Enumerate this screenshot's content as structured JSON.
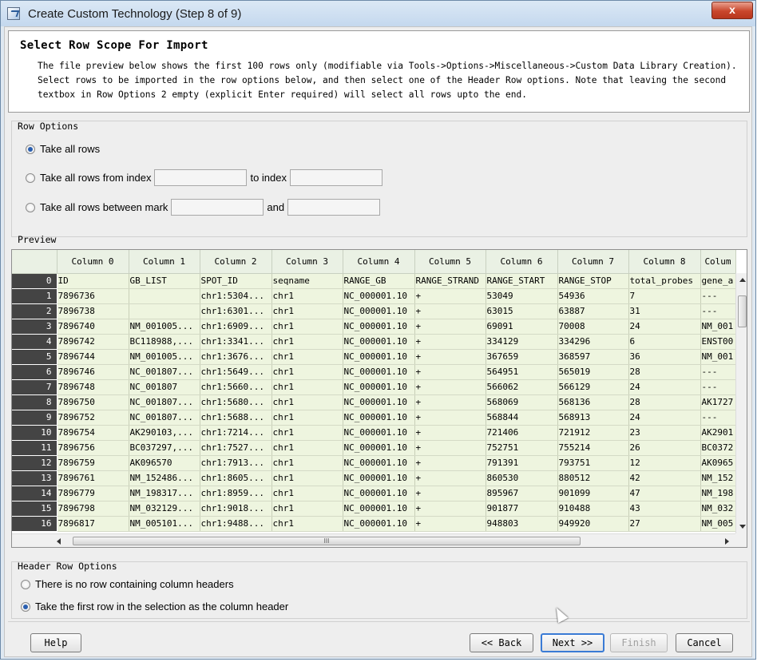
{
  "window": {
    "title": "Create Custom Technology (Step 8 of 9)",
    "close_label": "x"
  },
  "header": {
    "title": "Select Row Scope For Import",
    "description": "The file preview below shows the first 100 rows only (modifiable via Tools->Options->Miscellaneous->Custom Data Library Creation). Select rows to be imported in the row options below, and then select one of the Header Row options. Note that leaving the second textbox in Row Options 2 empty (explicit Enter required) will select all rows upto the end."
  },
  "row_options": {
    "label": "Row Options",
    "all_rows": "Take all rows",
    "from_index": "Take all rows from index",
    "to_index": "to index",
    "between_mark": "Take all rows between mark",
    "and": "and",
    "selected": "all_rows"
  },
  "preview": {
    "label": "Preview",
    "columns": [
      "Column 0",
      "Column 1",
      "Column 2",
      "Column 3",
      "Column 4",
      "Column 5",
      "Column 6",
      "Column 7",
      "Column 8",
      "Colum"
    ],
    "rows": [
      [
        "0",
        "ID",
        "GB_LIST",
        "SPOT_ID",
        "seqname",
        "RANGE_GB",
        "RANGE_STRAND",
        "RANGE_START",
        "RANGE_STOP",
        "total_probes",
        "gene_a"
      ],
      [
        "1",
        "7896736",
        "",
        "chr1:5304...",
        "chr1",
        "NC_000001.10",
        "+",
        "53049",
        "54936",
        "7",
        "---"
      ],
      [
        "2",
        "7896738",
        "",
        "chr1:6301...",
        "chr1",
        "NC_000001.10",
        "+",
        "63015",
        "63887",
        "31",
        "---"
      ],
      [
        "3",
        "7896740",
        "NM_001005...",
        "chr1:6909...",
        "chr1",
        "NC_000001.10",
        "+",
        "69091",
        "70008",
        "24",
        "NM_001"
      ],
      [
        "4",
        "7896742",
        "BC118988,...",
        "chr1:3341...",
        "chr1",
        "NC_000001.10",
        "+",
        "334129",
        "334296",
        "6",
        "ENST00"
      ],
      [
        "5",
        "7896744",
        "NM_001005...",
        "chr1:3676...",
        "chr1",
        "NC_000001.10",
        "+",
        "367659",
        "368597",
        "36",
        "NM_001"
      ],
      [
        "6",
        "7896746",
        "NC_001807...",
        "chr1:5649...",
        "chr1",
        "NC_000001.10",
        "+",
        "564951",
        "565019",
        "28",
        "---"
      ],
      [
        "7",
        "7896748",
        "NC_001807",
        "chr1:5660...",
        "chr1",
        "NC_000001.10",
        "+",
        "566062",
        "566129",
        "24",
        "---"
      ],
      [
        "8",
        "7896750",
        "NC_001807...",
        "chr1:5680...",
        "chr1",
        "NC_000001.10",
        "+",
        "568069",
        "568136",
        "28",
        "AK1727"
      ],
      [
        "9",
        "7896752",
        "NC_001807...",
        "chr1:5688...",
        "chr1",
        "NC_000001.10",
        "+",
        "568844",
        "568913",
        "24",
        "---"
      ],
      [
        "10",
        "7896754",
        "AK290103,...",
        "chr1:7214...",
        "chr1",
        "NC_000001.10",
        "+",
        "721406",
        "721912",
        "23",
        "AK2901"
      ],
      [
        "11",
        "7896756",
        "BC037297,...",
        "chr1:7527...",
        "chr1",
        "NC_000001.10",
        "+",
        "752751",
        "755214",
        "26",
        "BC0372"
      ],
      [
        "12",
        "7896759",
        "AK096570",
        "chr1:7913...",
        "chr1",
        "NC_000001.10",
        "+",
        "791391",
        "793751",
        "12",
        "AK0965"
      ],
      [
        "13",
        "7896761",
        "NM_152486...",
        "chr1:8605...",
        "chr1",
        "NC_000001.10",
        "+",
        "860530",
        "880512",
        "42",
        "NM_152"
      ],
      [
        "14",
        "7896779",
        "NM_198317...",
        "chr1:8959...",
        "chr1",
        "NC_000001.10",
        "+",
        "895967",
        "901099",
        "47",
        "NM_198"
      ],
      [
        "15",
        "7896798",
        "NM_032129...",
        "chr1:9018...",
        "chr1",
        "NC_000001.10",
        "+",
        "901877",
        "910488",
        "43",
        "NM_032"
      ],
      [
        "16",
        "7896817",
        "NM_005101...",
        "chr1:9488...",
        "chr1",
        "NC_000001.10",
        "+",
        "948803",
        "949920",
        "27",
        "NM_005"
      ]
    ],
    "hscroll_grip": "III"
  },
  "header_row_options": {
    "label": "Header Row Options",
    "no_header": "There is no row containing column headers",
    "first_row": "Take the first row in the selection as the column header",
    "selected": "first_row"
  },
  "buttons": {
    "help": "Help",
    "back": "<< Back",
    "next": "Next >>",
    "finish": "Finish",
    "cancel": "Cancel"
  }
}
